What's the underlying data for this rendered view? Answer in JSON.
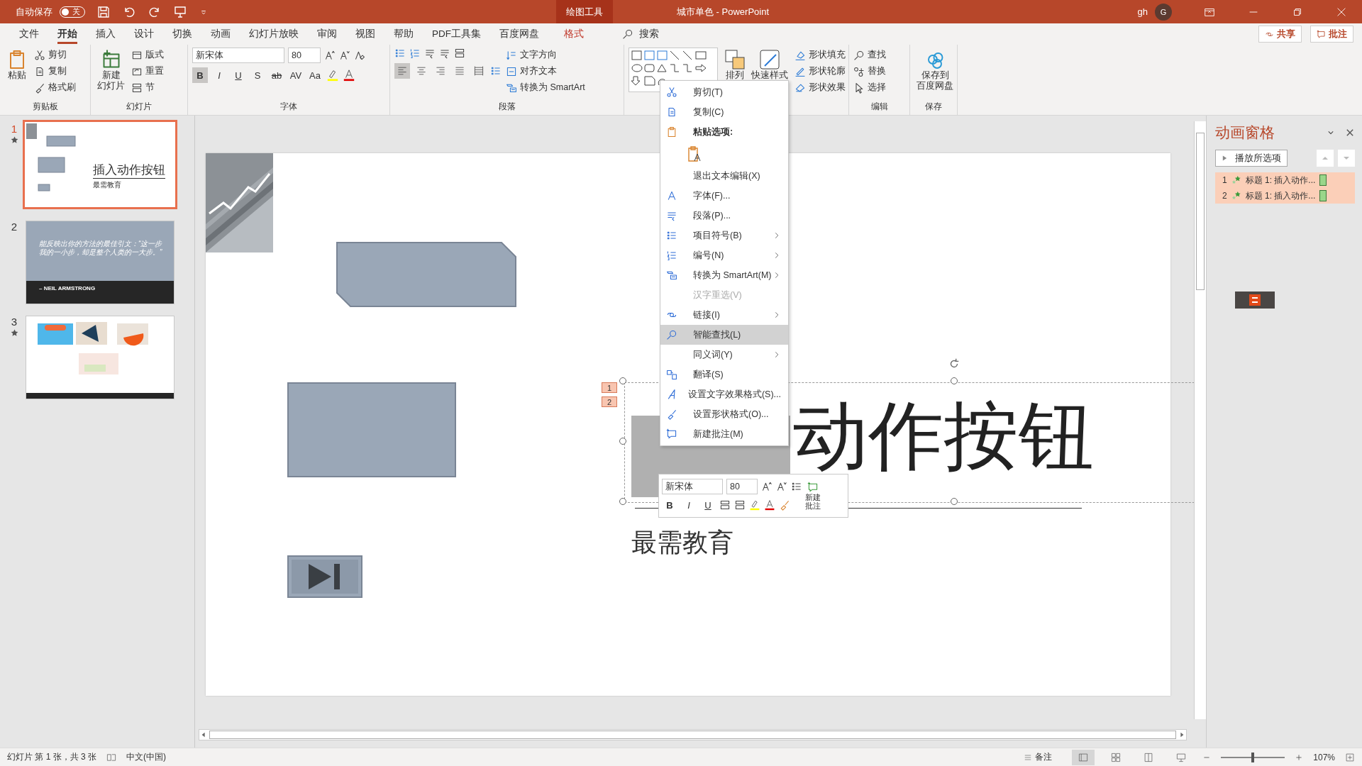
{
  "title_bar": {
    "autosave_label": "自动保存",
    "autosave": {
      "on": false,
      "label": "关"
    },
    "context_tab": "绘图工具",
    "title": "城市单色  -  PowerPoint",
    "user": "gh",
    "avatar": "G"
  },
  "menu_tabs": [
    {
      "label": "文件",
      "selected": false
    },
    {
      "label": "开始",
      "selected": true
    },
    {
      "label": "插入",
      "selected": false
    },
    {
      "label": "设计",
      "selected": false
    },
    {
      "label": "切换",
      "selected": false
    },
    {
      "label": "动画",
      "selected": false
    },
    {
      "label": "幻灯片放映",
      "selected": false
    },
    {
      "label": "审阅",
      "selected": false
    },
    {
      "label": "视图",
      "selected": false
    },
    {
      "label": "帮助",
      "selected": false
    },
    {
      "label": "PDF工具集",
      "selected": false
    },
    {
      "label": "百度网盘",
      "selected": false
    },
    {
      "label": "格式",
      "selected": false,
      "kind": "context"
    }
  ],
  "search": "搜索",
  "share": "共享",
  "comments": "批注",
  "clipboard": {
    "label": "剪贴板",
    "paste": "粘贴",
    "items": [
      "剪切",
      "复制",
      "格式刷"
    ]
  },
  "slides_group": {
    "label": "幻灯片",
    "new_slide": [
      "新建",
      "幻灯片"
    ],
    "items": [
      "版式",
      "重置",
      "节"
    ]
  },
  "font_group": {
    "label": "字体",
    "font": "新宋体",
    "size": "80",
    "format": [
      {
        "label": "B",
        "selected": true
      },
      {
        "label": "I",
        "selected": false
      },
      {
        "label": "U",
        "selected": false
      },
      {
        "label": "S",
        "selected": false
      },
      {
        "label": "ab",
        "selected": false
      },
      {
        "label": "AV",
        "selected": false
      },
      {
        "label": "Aa",
        "selected": false
      }
    ]
  },
  "paragraph_group": {
    "label": "段落",
    "align": [
      {
        "selected": true
      },
      {
        "selected": false
      },
      {
        "selected": false
      },
      {
        "selected": false
      },
      {
        "selected": false
      }
    ],
    "items": [
      "文字方向",
      "对齐文本",
      "转换为 SmartArt"
    ]
  },
  "drawing_group": {
    "arrange": "排列",
    "quick_styles": "快速样式",
    "items": [
      "形状填充",
      "形状轮廓",
      "形状效果"
    ]
  },
  "editing_group": {
    "label": "编辑",
    "items": [
      "查找",
      "替换",
      "选择"
    ]
  },
  "save_group": {
    "label": "保存",
    "button": [
      "保存到",
      "百度网盘"
    ]
  },
  "thumbnails": [
    {
      "number": "1",
      "selected": true,
      "animated": true,
      "kind": "title",
      "title": "插入动作按钮",
      "subtitle": "最需教育"
    },
    {
      "number": "2",
      "selected": false,
      "animated": false,
      "kind": "quote",
      "quote": "能反映出你的方法的最佳引文：“这一步我的一小步，却是整个人类的一大步。”",
      "author": "– NEIL ARMSTRONG"
    },
    {
      "number": "3",
      "selected": false,
      "animated": true,
      "kind": "pictures"
    }
  ],
  "slide": {
    "title": "动作按钮",
    "subtitle": "最需教育",
    "markers": [
      "1",
      "2"
    ]
  },
  "context_menu": [
    {
      "kind": "item",
      "label": "剪切(T)",
      "submenu": false,
      "disabled": false,
      "selected": false
    },
    {
      "kind": "item",
      "label": "复制(C)",
      "submenu": false,
      "disabled": false,
      "selected": false
    },
    {
      "kind": "header",
      "label": "粘贴选项:"
    },
    {
      "kind": "paste"
    },
    {
      "kind": "item",
      "label": "退出文本编辑(X)",
      "submenu": false,
      "disabled": false,
      "selected": false
    },
    {
      "kind": "item",
      "label": "字体(F)...",
      "submenu": false,
      "disabled": false,
      "selected": false
    },
    {
      "kind": "item",
      "label": "段落(P)...",
      "submenu": false,
      "disabled": false,
      "selected": false
    },
    {
      "kind": "item",
      "label": "项目符号(B)",
      "submenu": true,
      "disabled": false,
      "selected": false
    },
    {
      "kind": "item",
      "label": "编号(N)",
      "submenu": true,
      "disabled": false,
      "selected": false
    },
    {
      "kind": "item",
      "label": "转换为 SmartArt(M)",
      "submenu": true,
      "disabled": false,
      "selected": false
    },
    {
      "kind": "item",
      "label": "汉字重选(V)",
      "submenu": false,
      "disabled": true,
      "selected": false
    },
    {
      "kind": "item",
      "label": "链接(I)",
      "submenu": true,
      "disabled": false,
      "selected": false
    },
    {
      "kind": "item",
      "label": "智能查找(L)",
      "submenu": false,
      "disabled": false,
      "selected": true
    },
    {
      "kind": "item",
      "label": "同义词(Y)",
      "submenu": true,
      "disabled": false,
      "selected": false
    },
    {
      "kind": "item",
      "label": "翻译(S)",
      "submenu": false,
      "disabled": false,
      "selected": false
    },
    {
      "kind": "item",
      "label": "设置文字效果格式(S)...",
      "submenu": false,
      "disabled": false,
      "selected": false
    },
    {
      "kind": "item",
      "label": "设置形状格式(O)...",
      "submenu": false,
      "disabled": false,
      "selected": false
    },
    {
      "kind": "item",
      "label": "新建批注(M)",
      "submenu": false,
      "disabled": false,
      "selected": false
    }
  ],
  "mini_toolbar": {
    "font": "新宋体",
    "size": "80",
    "format": [
      {
        "label": "B",
        "selected": false
      },
      {
        "label": "I",
        "selected": false
      },
      {
        "label": "U",
        "selected": false
      }
    ],
    "comment": [
      "新建",
      "批注"
    ]
  },
  "animation_pane": {
    "title": "动画窗格",
    "play": "播放所选项",
    "items": [
      {
        "number": "1",
        "label": "标题 1: 插入动作...",
        "selected": true
      },
      {
        "number": "2",
        "label": "标题 1: 插入动作...",
        "selected": true
      }
    ]
  },
  "status_bar": {
    "slide_info": "幻灯片 第 1 张，共 3 张",
    "language": "中文(中国)",
    "notes": "备注",
    "views": [
      {
        "selected": true
      },
      {
        "selected": false
      },
      {
        "selected": false
      },
      {
        "selected": false
      }
    ],
    "zoom_slider": {
      "level": 0.5
    },
    "zoom": "107%"
  }
}
